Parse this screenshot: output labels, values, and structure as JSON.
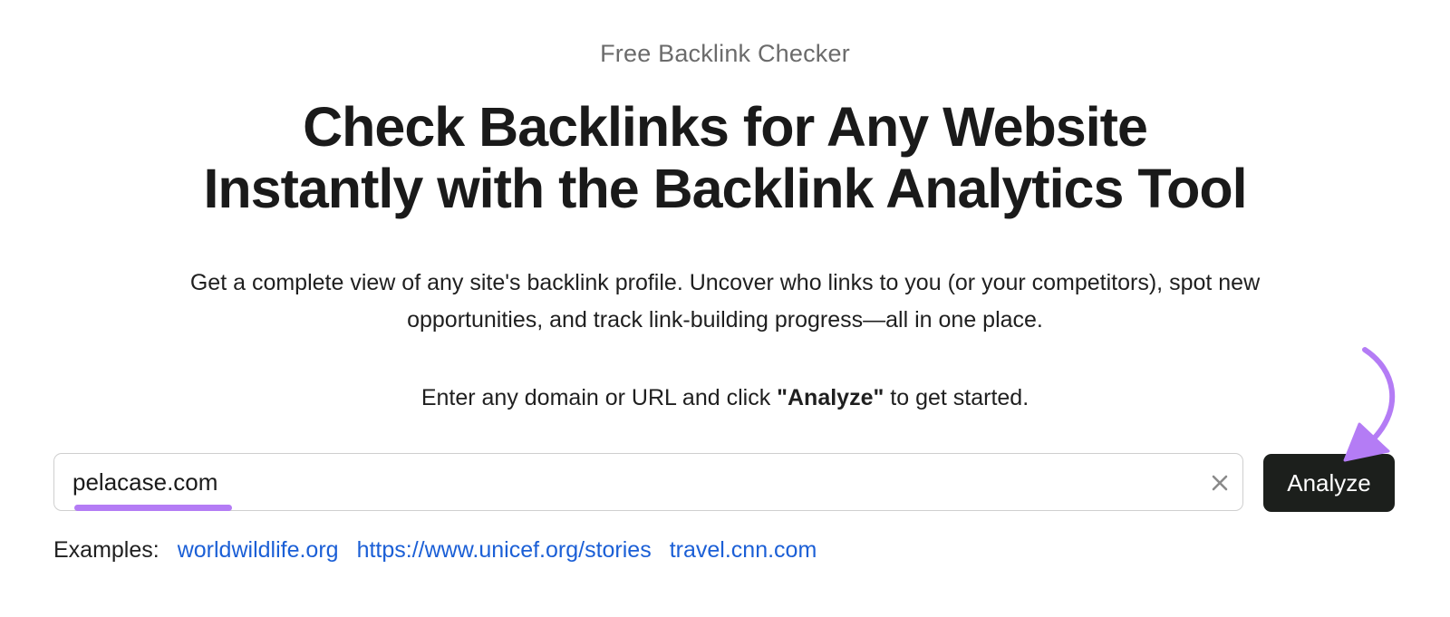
{
  "header": {
    "eyebrow": "Free Backlink Checker",
    "title_line1": "Check Backlinks for Any Website",
    "title_line2": "Instantly with the Backlink Analytics Tool"
  },
  "intro": {
    "line1": "Get a complete view of any site's backlink profile. Uncover who links to you (or your competitors), spot new",
    "line2": "opportunities, and track link-building progress—all in one place."
  },
  "instruction": {
    "before": "Enter any domain or URL and click ",
    "emphasis": "\"Analyze\"",
    "after": " to get started."
  },
  "search": {
    "value": "pelacase.com",
    "placeholder": "",
    "clear_icon": "close-icon",
    "button_label": "Analyze"
  },
  "examples": {
    "label": "Examples:",
    "links": [
      "worldwildlife.org",
      "https://www.unicef.org/stories",
      "travel.cnn.com"
    ]
  },
  "colors": {
    "accent": "#b47cf5",
    "button_bg": "#1c1f1c",
    "link": "#1b5fd6",
    "eyebrow": "#6b6b6b"
  },
  "annotation": {
    "icon": "curved-arrow-icon"
  }
}
